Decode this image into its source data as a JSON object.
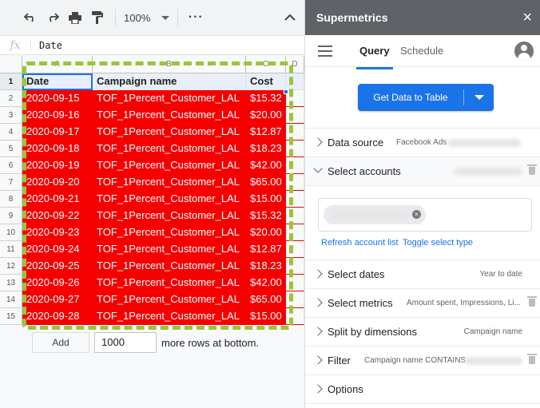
{
  "toolbar": {
    "zoom": "100%",
    "more": "⋮"
  },
  "formula_bar": {
    "fx": "fx",
    "value": "Date"
  },
  "sheet": {
    "columns": [
      "A",
      "B",
      "C",
      "D"
    ],
    "row_numbers": [
      "1",
      "2",
      "3",
      "4",
      "5",
      "6",
      "7",
      "8",
      "9",
      "10",
      "11",
      "12",
      "13",
      "14",
      "15"
    ],
    "headers": [
      "Date",
      "Campaign name",
      "Cost"
    ],
    "rows": [
      [
        "2020-09-15",
        "TOF_1Percent_Customer_LAL",
        "$15.32"
      ],
      [
        "2020-09-16",
        "TOF_1Percent_Customer_LAL",
        "$20.00"
      ],
      [
        "2020-09-17",
        "TOF_1Percent_Customer_LAL",
        "$12.87"
      ],
      [
        "2020-09-18",
        "TOF_1Percent_Customer_LAL",
        "$18.23"
      ],
      [
        "2020-09-19",
        "TOF_1Percent_Customer_LAL",
        "$42.00"
      ],
      [
        "2020-09-20",
        "TOF_1Percent_Customer_LAL",
        "$65.00"
      ],
      [
        "2020-09-21",
        "TOF_1Percent_Customer_LAL",
        "$15.00"
      ],
      [
        "2020-09-22",
        "TOF_1Percent_Customer_LAL",
        "$15.32"
      ],
      [
        "2020-09-23",
        "TOF_1Percent_Customer_LAL",
        "$20.00"
      ],
      [
        "2020-09-24",
        "TOF_1Percent_Customer_LAL",
        "$12.87"
      ],
      [
        "2020-09-25",
        "TOF_1Percent_Customer_LAL",
        "$18.23"
      ],
      [
        "2020-09-26",
        "TOF_1Percent_Customer_LAL",
        "$42.00"
      ],
      [
        "2020-09-27",
        "TOF_1Percent_Customer_LAL",
        "$65.00"
      ],
      [
        "2020-09-28",
        "TOF_1Percent_Customer_LAL",
        "$15.00"
      ]
    ],
    "add_rows": {
      "button": "Add",
      "count": "1000",
      "suffix": "more rows at bottom."
    },
    "colors": {
      "highlight_fill": "#f40000",
      "dashed_border": "#9bc43c",
      "selection": "#1a73e8"
    }
  },
  "panel": {
    "title": "Supermetrics",
    "close": "×",
    "tabs": [
      "Query",
      "Schedule"
    ],
    "active_tab": "Query",
    "get_data_button": "Get Data to Table",
    "sections": {
      "data_source": {
        "label": "Data source",
        "summary": "Facebook Ads"
      },
      "select_accounts": {
        "label": "Select accounts"
      },
      "select_dates": {
        "label": "Select dates",
        "summary": "Year to date"
      },
      "select_metrics": {
        "label": "Select metrics",
        "summary": "Amount spent, Impressions, Li..."
      },
      "split_by_dimensions": {
        "label": "Split by dimensions",
        "summary": "Campaign name"
      },
      "filter": {
        "label": "Filter",
        "summary": "Campaign name CONTAINS"
      },
      "options": {
        "label": "Options"
      }
    },
    "account_links": {
      "refresh": "Refresh account list",
      "toggle": "Toggle select type"
    },
    "chip_close": "×",
    "colors": {
      "header_bg": "#5f6368",
      "accent": "#1a73e8"
    }
  }
}
